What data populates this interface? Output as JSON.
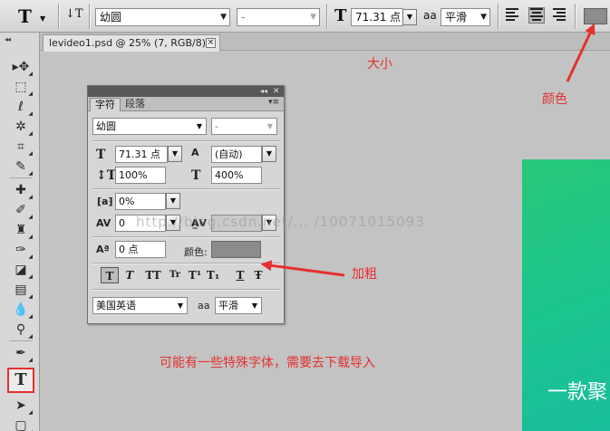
{
  "colors": {
    "annotation": "#e53030",
    "swatch": "#8c8c8c",
    "image_green": "#22c47f"
  },
  "options_bar": {
    "tool_preset_icon": "T",
    "orientation_icon": "text-orientation-icon",
    "font_family": "幼圆",
    "font_style": "-",
    "font_size": "71.31 点",
    "antialias_icon": "aa",
    "antialias": "平滑"
  },
  "document": {
    "tab_title": "levideo1.psd @ 25% (7, RGB/8)",
    "close": "×"
  },
  "image_text": "一款聚",
  "panel": {
    "tabs": [
      "字符",
      "段落"
    ],
    "font_family": "幼圆",
    "font_style": "-",
    "size": "71.31 点",
    "leading": "(自动)",
    "vertical_scale": "100%",
    "horizontal_scale": "400%",
    "tracking": "0%",
    "kerning": "0",
    "baseline_shift": "0 点",
    "color_label": "颜色:",
    "language": "美国英语",
    "antialias_icon": "aa",
    "antialias": "平滑",
    "style_buttons": [
      "T",
      "T",
      "TT",
      "Tr",
      "T¹",
      "T₁",
      "T",
      "Ŧ"
    ]
  },
  "watermark": "http://blog.csdn.net/...  /10071015093",
  "annotations": {
    "size": "大小",
    "color": "颜色",
    "bold": "加粗",
    "note": "可能有一些特殊字体，需要去下载导入"
  }
}
